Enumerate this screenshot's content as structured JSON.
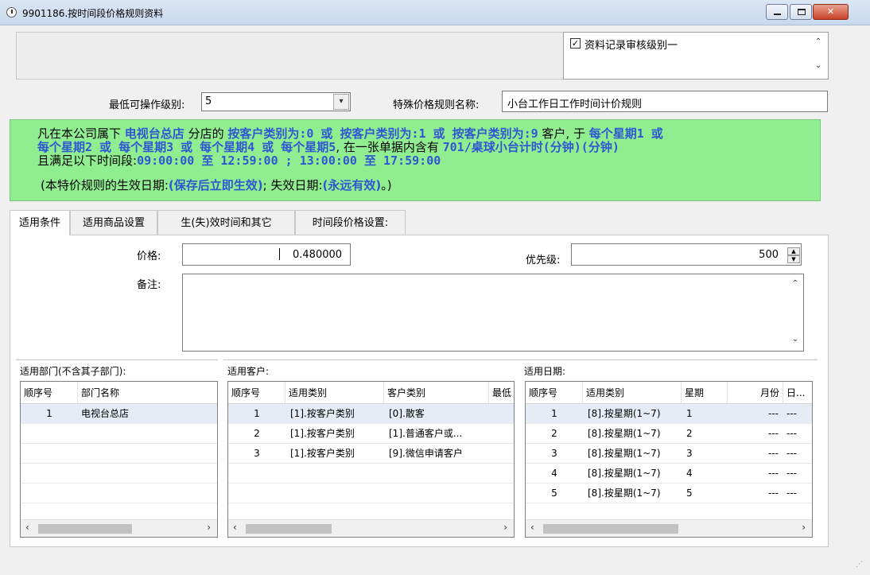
{
  "window": {
    "title": "9901186.按时间段价格规则资料",
    "min_glyph": "",
    "max_glyph": "",
    "close_glyph": "✕"
  },
  "audit": {
    "checkbox_label": "资料记录审核级别一",
    "checked_mark": "✓",
    "scroll_up": "⌃",
    "scroll_down": "⌄"
  },
  "form": {
    "min_level_label": "最低可操作级别:",
    "min_level_value": "5",
    "rule_name_label": "特殊价格规则名称:",
    "rule_name_value": "小台工作日工作时间计价规则"
  },
  "rule": {
    "l1": [
      "凡在本公司属下 ",
      "电视台总店",
      " 分店的 ",
      "按客户类别为:0 或 按客户类别为:1 或 按客户类别为:9",
      " 客户, 于 ",
      "每个星期1 或"
    ],
    "l2": [
      "每个星期2 或 每个星期3 或 每个星期4 或 每个星期5",
      ", 在一张单据内含有 ",
      "701/桌球小台计时(分钟)(分钟)"
    ],
    "l3": [
      "且满足以下时间段:",
      "09:00:00 至 12:59:00 ; 13:00:00 至 17:59:00"
    ],
    "l4": [
      "(本特价规则的生效日期:",
      "(保存后立即生效)",
      "; 失效日期:",
      "(永远有效)",
      "。)"
    ]
  },
  "tabs": [
    "适用条件",
    "适用商品设置",
    "生(失)效时间和其它",
    "时间段价格设置:"
  ],
  "conditions": {
    "price_label": "价格:",
    "price_value": "0.480000",
    "priority_label": "优先级:",
    "priority_value": "500",
    "remark_label": "备注:"
  },
  "departments": {
    "title": "适用部门(不含其子部门):",
    "columns": [
      "顺序号",
      "部门名称"
    ],
    "rows": [
      [
        "1",
        "电视台总店"
      ]
    ]
  },
  "customers": {
    "title": "适用客户:",
    "columns": [
      "顺序号",
      "适用类别",
      "客户类别",
      "最低"
    ],
    "rows": [
      [
        "1",
        "[1].按客户类别",
        "[0].散客"
      ],
      [
        "2",
        "[1].按客户类别",
        "[1].普通客户或..."
      ],
      [
        "3",
        "[1].按客户类别",
        "[9].微信申请客户"
      ]
    ]
  },
  "dates": {
    "title": "适用日期:",
    "columns": [
      "顺序号",
      "适用类别",
      "星期",
      "月份",
      "日..."
    ],
    "rows": [
      [
        "1",
        "[8].按星期(1~7)",
        "1",
        "---",
        "---"
      ],
      [
        "2",
        "[8].按星期(1~7)",
        "2",
        "---",
        "---"
      ],
      [
        "3",
        "[8].按星期(1~7)",
        "3",
        "---",
        "---"
      ],
      [
        "4",
        "[8].按星期(1~7)",
        "4",
        "---",
        "---"
      ],
      [
        "5",
        "[8].按星期(1~7)",
        "5",
        "---",
        "---"
      ]
    ]
  },
  "scroll": {
    "left": "‹",
    "right": "›"
  }
}
